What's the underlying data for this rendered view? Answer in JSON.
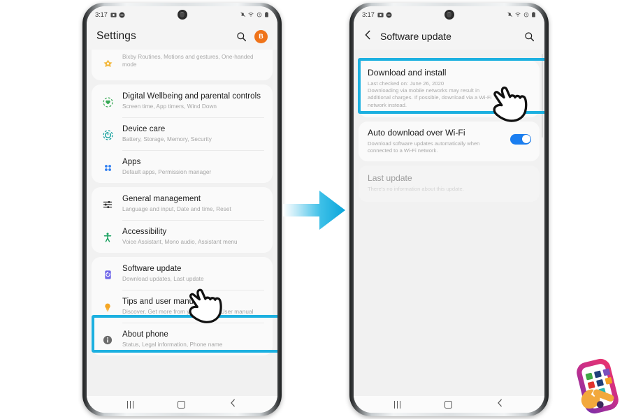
{
  "meta": {
    "accent_cyan": "#1cb0e0",
    "toggle_blue": "#1a7ef0",
    "avatar_orange": "#ef7319"
  },
  "left_phone": {
    "status_bar": {
      "time": "3:17",
      "left_icons": [
        "screenshot-icon",
        "mute-icon"
      ],
      "right_icons": [
        "mute-bell-icon",
        "wifi-icon",
        "alarm-icon",
        "battery-icon"
      ]
    },
    "header": {
      "title": "Settings",
      "search_icon": "search-icon",
      "avatar_letter": "B"
    },
    "partial_item": {
      "icon": "bixby-advanced-features-icon",
      "subtitle": "Bixby Routines, Motions and gestures, One-handed mode"
    },
    "items": [
      {
        "icon": "digital-wellbeing-icon",
        "title": "Digital Wellbeing and parental controls",
        "subtitle": "Screen time, App timers, Wind Down"
      },
      {
        "icon": "device-care-icon",
        "title": "Device care",
        "subtitle": "Battery, Storage, Memory, Security"
      },
      {
        "icon": "apps-icon",
        "title": "Apps",
        "subtitle": "Default apps, Permission manager"
      },
      {
        "icon": "general-management-icon",
        "title": "General management",
        "subtitle": "Language and input, Date and time, Reset"
      },
      {
        "icon": "accessibility-icon",
        "title": "Accessibility",
        "subtitle": "Voice Assistant, Mono audio, Assistant menu"
      },
      {
        "icon": "software-update-icon",
        "title": "Software update",
        "subtitle": "Download updates, Last update",
        "highlighted": true
      },
      {
        "icon": "tips-icon",
        "title": "Tips and user manual",
        "subtitle": "Discover, Get more from your Galaxy, User manual"
      },
      {
        "icon": "about-phone-icon",
        "title": "About phone",
        "subtitle": "Status, Legal information, Phone name"
      }
    ],
    "nav_bar": {
      "recents": "recents-icon",
      "home": "home-icon",
      "back": "back-icon"
    }
  },
  "right_phone": {
    "status_bar": {
      "time": "3:17",
      "left_icons": [
        "screenshot-icon",
        "mute-icon"
      ],
      "right_icons": [
        "mute-bell-icon",
        "wifi-icon",
        "alarm-icon",
        "battery-icon"
      ]
    },
    "header": {
      "back_icon": "back-chevron-icon",
      "title": "Software update",
      "search_icon": "search-icon"
    },
    "download_and_install": {
      "title": "Download and install",
      "last_checked": "Last checked on: June 26, 2020",
      "description": "Downloading via mobile networks may result in additional charges. If possible, download via a Wi-Fi network instead.",
      "highlighted": true
    },
    "auto_download": {
      "title": "Auto download over Wi-Fi",
      "subtitle": "Download software updates automatically when connected to a Wi-Fi network.",
      "toggle_state": "on"
    },
    "last_update": {
      "title": "Last update",
      "subtitle": "There's no information about this update."
    },
    "nav_bar": {
      "recents": "recents-icon",
      "home": "home-icon",
      "back": "back-icon"
    }
  },
  "arrow": {
    "name": "flow-arrow-right",
    "color": "#1cb0e0"
  },
  "logo": {
    "name": "app-repair-logo"
  }
}
